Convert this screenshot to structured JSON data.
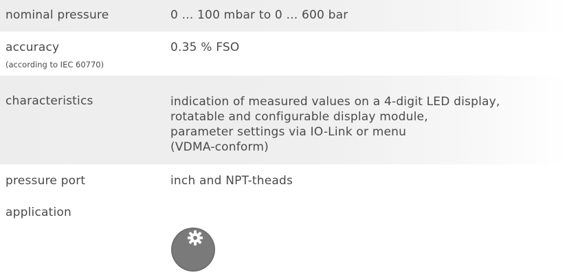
{
  "specs": {
    "nominal_pressure": {
      "label": "nominal pressure",
      "value": "0 ... 100 mbar to 0 ... 600 bar"
    },
    "accuracy": {
      "label": "accuracy",
      "sublabel": "(according to IEC 60770)",
      "value": "0.35 % FSO"
    },
    "characteristics": {
      "label": "characteristics",
      "lines": [
        "indication of measured values on a 4-digit LED display,",
        "rotatable and configurable display module,",
        "parameter settings via IO-Link or menu",
        "(VDMA-conform)"
      ]
    },
    "pressure_port": {
      "label": "pressure port",
      "value": "inch and NPT-theads"
    },
    "application": {
      "label": "application",
      "icon": "gear-icon"
    }
  },
  "colors": {
    "text": "#4a4a4a",
    "row_shade": "#eeeeee",
    "icon_bg": "#6f6f6f"
  }
}
